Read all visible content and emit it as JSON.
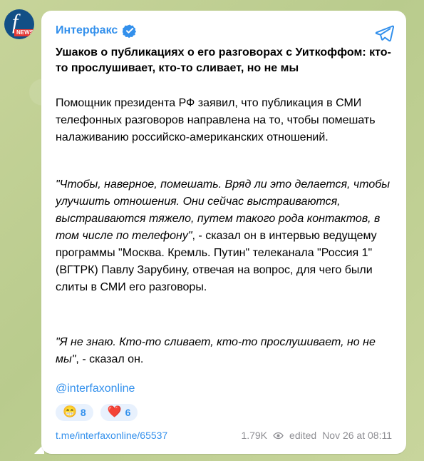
{
  "channel": {
    "name": "Интерфакс",
    "avatar_text": "f",
    "avatar_badge": "NEWS"
  },
  "post": {
    "headline": "Ушаков о публикациях о его разговорах с Уиткоффом: кто-то прослушивает, кто-то сливает, но не мы",
    "paragraph_1": "Помощник президента РФ заявил, что публикация в СМИ телефонных разговоров направлена на то, чтобы помешать налаживанию российско-американских отношений.",
    "quote_1": "\"Чтобы, наверное, помешать. Вряд ли это делается, чтобы улучшить отношения. Они сейчас выстраиваются, выстраиваются тяжело, путем такого рода контактов, в том числе по телефону\"",
    "paragraph_2_rest": ", - сказал он в интервью ведущему программы \"Москва. Кремль. Путин\" телеканала \"Россия 1\" (ВГТРК) Павлу Зарубину, отвечая на вопрос, для чего были слиты в СМИ его разговоры.",
    "quote_2": "\"Я не знаю. Кто-то сливает, кто-то прослушивает, но не мы\"",
    "paragraph_3_rest": ", - сказал он.",
    "handle": "@interfaxonline"
  },
  "reactions": [
    {
      "emoji": "😁",
      "count": "8"
    },
    {
      "emoji": "❤️",
      "count": "6"
    }
  ],
  "footer": {
    "link": "t.me/interfaxonline/65537",
    "views": "1.79K",
    "edited": "edited",
    "date": "Nov 26 at 08:11"
  },
  "icons": {
    "share": "telegram-share-icon",
    "verified": "verified-check-icon",
    "views": "eye-icon"
  },
  "colors": {
    "accent": "#3390ec",
    "avatar_bg": "#124f86",
    "badge_red": "#e53935"
  }
}
